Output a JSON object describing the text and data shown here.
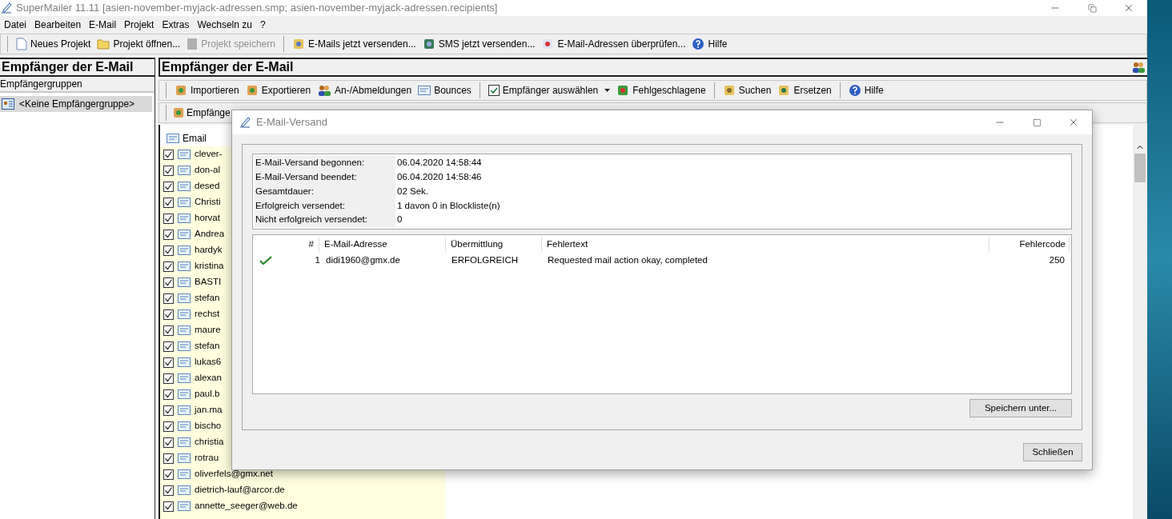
{
  "window": {
    "title": "SuperMailer 11.11 [asien-november-myjack-adressen.smp; asien-november-myjack-adressen.recipients]"
  },
  "menu": [
    "Datei",
    "Bearbeiten",
    "E-Mail",
    "Projekt",
    "Extras",
    "Wechseln zu",
    "?"
  ],
  "toolbar": [
    [
      {
        "label": "Neues Projekt",
        "disabled": false
      },
      {
        "label": "Projekt öffnen...",
        "disabled": false
      },
      {
        "label": "Projekt speichern",
        "disabled": true
      }
    ],
    [
      {
        "label": "E-Mails jetzt versenden...",
        "disabled": false
      },
      {
        "label": "SMS jetzt versenden...",
        "disabled": false
      },
      {
        "label": "E-Mail-Adressen überprüfen...",
        "disabled": false
      },
      {
        "label": "Hilfe",
        "disabled": false
      }
    ]
  ],
  "left_pane": {
    "title": "Empfänger der E-Mail",
    "section": "Empfängergruppen",
    "groups": [
      {
        "label": "<Keine Empfängergruppe>",
        "selected": true
      }
    ]
  },
  "right_pane": {
    "title": "Empfänger der E-Mail",
    "toolbar": [
      [
        {
          "label": "Importieren",
          "dropdown": false
        },
        {
          "label": "Exportieren",
          "dropdown": false
        },
        {
          "label": "An-/Abmeldungen",
          "dropdown": false
        },
        {
          "label": "Bounces",
          "dropdown": false
        }
      ],
      [
        {
          "label": "Empfänger auswählen",
          "dropdown": true
        },
        {
          "label": "Fehlgeschlagene",
          "dropdown": false
        }
      ],
      [
        {
          "label": "Suchen",
          "dropdown": false
        },
        {
          "label": "Ersetzen",
          "dropdown": false
        }
      ],
      [
        {
          "label": "Hilfe",
          "dropdown": false
        }
      ]
    ],
    "toolbar_2": [
      "Empfänge"
    ],
    "list": {
      "column": "Email",
      "rows": [
        {
          "email": "clever-",
          "checked": true
        },
        {
          "email": "don-al",
          "checked": true
        },
        {
          "email": "desed",
          "checked": true
        },
        {
          "email": "Christi",
          "checked": true
        },
        {
          "email": "horvat",
          "checked": true
        },
        {
          "email": "Andrea",
          "checked": true
        },
        {
          "email": "hardyk",
          "checked": true
        },
        {
          "email": "kristina",
          "checked": true
        },
        {
          "email": "BASTI",
          "checked": true
        },
        {
          "email": "stefan",
          "checked": true
        },
        {
          "email": "rechst",
          "checked": true
        },
        {
          "email": "maure",
          "checked": true
        },
        {
          "email": "stefan",
          "checked": true
        },
        {
          "email": "lukas6",
          "checked": true
        },
        {
          "email": "alexan",
          "checked": true
        },
        {
          "email": "paul.b",
          "checked": true
        },
        {
          "email": "jan.ma",
          "checked": true
        },
        {
          "email": "bischo",
          "checked": true
        },
        {
          "email": "christia",
          "checked": true
        },
        {
          "email": "rotrau",
          "checked": true
        },
        {
          "email": "oliverfels@gmx.net",
          "checked": true
        },
        {
          "email": "dietrich-lauf@arcor.de",
          "checked": true
        },
        {
          "email": "annette_seeger@web.de",
          "checked": true
        }
      ]
    }
  },
  "dialog": {
    "title": "E-Mail-Versand",
    "summary": [
      {
        "label": "E-Mail-Versand begonnen:",
        "value": "06.04.2020 14:58:44"
      },
      {
        "label": "E-Mail-Versand beendet:",
        "value": "06.04.2020 14:58:46"
      },
      {
        "label": "Gesamtdauer:",
        "value": "02 Sek."
      },
      {
        "label": "Erfolgreich versendet:",
        "value": "1 davon 0 in Blockliste(n)"
      },
      {
        "label": "Nicht erfolgreich versendet:",
        "value": "0"
      }
    ],
    "table": {
      "columns": [
        "#",
        "E-Mail-Adresse",
        "Übermittlung",
        "Fehlertext",
        "Fehlercode"
      ],
      "rows": [
        {
          "succeeded": true,
          "number": "1",
          "email": "didi1960@gmx.de",
          "transmission": "ERFOLGREICH",
          "error_text": "Requested mail action okay, completed",
          "error_code": "250"
        }
      ]
    },
    "buttons": [
      "Speichern unter...",
      "Schließen"
    ]
  }
}
